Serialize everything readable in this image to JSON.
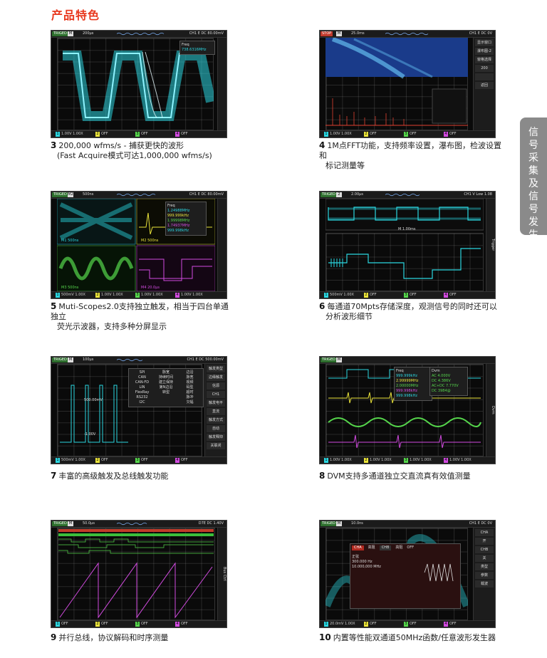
{
  "heading": "产品特色",
  "side_tab": [
    "信",
    "号",
    "采",
    "集",
    "及",
    "信",
    "号",
    "发",
    "生"
  ],
  "features": [
    {
      "num": "3",
      "text": "200,000 wfms/s - 捕获更快的波形",
      "sub": "(Fast Acquire模式可达1,000,000 wfms/s)",
      "screen": {
        "trig": "TRIGED",
        "tb": "200μs",
        "ch": "CH1 E DC 80.00mV",
        "popup_title": "Freq",
        "popup_val": "738.6316MHz",
        "bottom": [
          "1 1.00V 1.00X",
          "2 OFF",
          "3 OFF",
          "4 OFF"
        ]
      }
    },
    {
      "num": "4",
      "text": "1M点FFT功能，支持频率设置，瀑布图，检波设置和",
      "sub": "标记测量等",
      "screen": {
        "trig": "STOP",
        "tb": "25.0ms",
        "ch": "CH1 E DC 0V",
        "menu": [
          "显示窗口",
          "瀑布图-2",
          "窗格选择",
          "200",
          "",
          "返回"
        ],
        "bottom": [
          "1 1.00V 1.00X",
          "2 OFF",
          "3 OFF",
          "4 OFF"
        ]
      }
    },
    {
      "num": "5",
      "text": "Muti-Scopes2.0支持独立触发，相当于四台单通独立",
      "sub": "荧光示波器，支持多种分屏显示",
      "screen": {
        "trig": "TRIGED",
        "tb": "500ns",
        "ch": "CH1 E DC 80.00mV",
        "popup_title": "Freq",
        "rows": [
          "1.24988MHz",
          "999.999kHz",
          "1.99998MHz",
          "1.74937MHz",
          "999.998kHz"
        ],
        "labels": [
          "M1 500ns",
          "M2 500ns",
          "M3 500ns",
          "M4 20.0μs"
        ],
        "bottom": [
          "1 500mV 1.00X",
          "2 1.00V 1.00X",
          "3 1.00V 1.00X",
          "4 1.00V 1.00X"
        ]
      }
    },
    {
      "num": "6",
      "text": "每通道70Mpts存储深度，观测信号的同时还可以",
      "sub": "分析波形细节",
      "screen": {
        "trig": "TRIGED",
        "tb": "2.00μs",
        "ch": "CH1 V Low 1.08",
        "zoom_label": "M 1.00ms",
        "side": "Trigger",
        "bottom": [
          "1 500mV 1.00X",
          "2 OFF",
          "3 OFF",
          "4 OFF"
        ]
      }
    },
    {
      "num": "7",
      "text": "丰富的高级触发及总线触发功能",
      "sub": "",
      "screen": {
        "trig": "TRIGED",
        "tb": "100μs",
        "ch": "CH1 E DC 500.00mV",
        "labels": [
          "500.00mV",
          "-1.00V"
        ],
        "table": [
          [
            "SPI",
            "脉宽",
            "边沿"
          ],
          [
            "CAN",
            "持续时间",
            "脉宽"
          ],
          [
            "CAN-FD",
            "建立保持",
            "视频"
          ],
          [
            "LIN",
            "第N边沿",
            "码型"
          ],
          [
            "FlexRay",
            "转型",
            "超时"
          ],
          [
            "RS232",
            "",
            "脉冲"
          ],
          [
            "I2C",
            "",
            "欠幅"
          ]
        ],
        "menu": [
          "触发类型",
          "边缘触发",
          "信源",
          "CH1",
          "触发电平",
          "直流",
          "触发方式",
          "自动",
          "触发释抑",
          "关联闭"
        ],
        "bottom": [
          "1 500mV 1.00X",
          "2 OFF",
          "3 OFF",
          "4 OFF"
        ]
      }
    },
    {
      "num": "8",
      "text": "DVM支持多通道独立交直流真有效值测量",
      "sub": "",
      "screen": {
        "trig": "TRIGED",
        "tb": "",
        "ch": "",
        "popup_title": "Freq",
        "popup2": "Dvm",
        "rows": [
          "999.999kHz",
          "2.99999MHz",
          "2.00000MHz",
          "999.998kHz",
          "999.998kHz"
        ],
        "dvm": [
          "AC 4.000V",
          "DC 4.386V",
          "AC+DC 7.770V",
          "DC 3984@"
        ],
        "side": "Dvm",
        "bottom": [
          "1 1.00V 1.00X",
          "2 1.00V 1.00X",
          "3 1.00V 1.00X",
          "4 1.00V 1.00X"
        ]
      }
    },
    {
      "num": "9",
      "text": "并行总线，协议解码和时序测量",
      "sub": "",
      "screen": {
        "trig": "TRIGED",
        "tb": "50.0μs",
        "ch": "D7E DC 1.40V",
        "side": "Bus Ctrl",
        "bottom": [
          "1 OFF",
          "2 OFF",
          "3 OFF",
          "4 OFF"
        ]
      }
    },
    {
      "num": "10",
      "text": "内置等性能双通道50MHz函数/任意波形发生器",
      "sub": "",
      "screen": {
        "trig": "TRIGED",
        "tb": "10.0ns",
        "ch": "CH1 E DC 0V",
        "popup_title": "Freq",
        "awg": [
          "CHA",
          "高阻",
          "CHB",
          "高阻",
          "OFF"
        ],
        "awg_rows": [
          "正弦",
          "300.000 Hz",
          "10.000,000 MHz"
        ],
        "menu": [
          "CHA",
          "开",
          "CHB",
          "关",
          "类型",
          "参数",
          "载波"
        ],
        "bottom": [
          "1 20.0mV 1.00X",
          "2 OFF",
          "3 OFF",
          "4 OFF"
        ]
      }
    }
  ],
  "colors": {
    "heading": "#e8381e",
    "cyan": "#2bd6e0",
    "yellow": "#e9e33a",
    "green": "#56d64c",
    "magenta": "#d24be0"
  }
}
